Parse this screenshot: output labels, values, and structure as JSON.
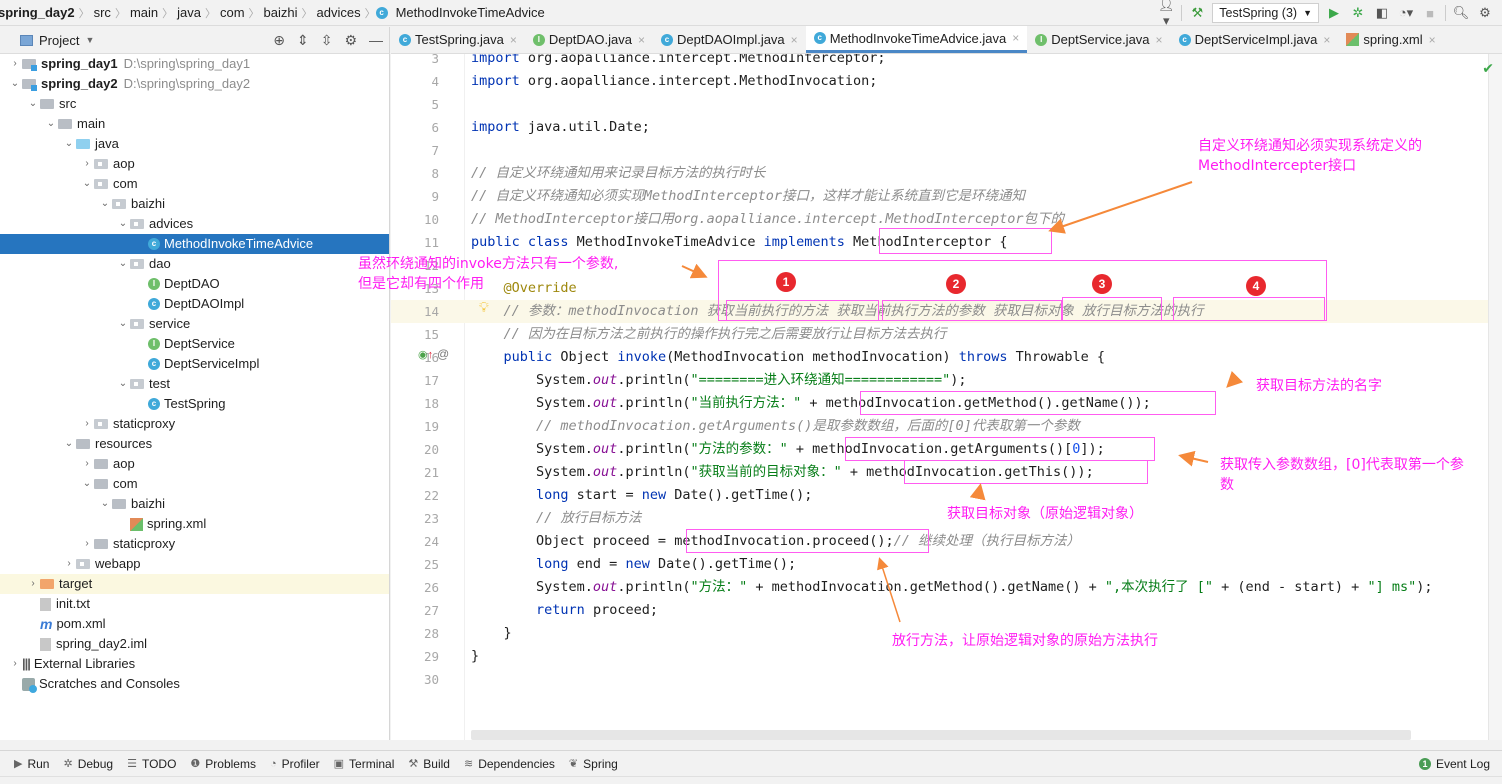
{
  "breadcrumb": [
    "spring_day2",
    "src",
    "main",
    "java",
    "com",
    "baizhi",
    "advices",
    "MethodInvokeTimeAdvice"
  ],
  "toolbar": {
    "run_config": "TestSpring (3)",
    "icons": [
      "user-icon",
      "build-hammer-icon",
      "run-icon",
      "debug-icon",
      "coverage-icon",
      "profile-icon",
      "stop-icon",
      "search-icon",
      "settings-icon"
    ]
  },
  "project_panel": {
    "title": "Project",
    "tree": [
      {
        "label": "spring_day1",
        "path": "D:\\spring\\spring_day1",
        "depth": 0,
        "arrow": "›",
        "icon": "module",
        "bold": true
      },
      {
        "label": "spring_day2",
        "path": "D:\\spring\\spring_day2",
        "depth": 0,
        "arrow": "⌄",
        "icon": "module",
        "bold": true
      },
      {
        "label": "src",
        "depth": 1,
        "arrow": "⌄",
        "icon": "folder"
      },
      {
        "label": "main",
        "depth": 2,
        "arrow": "⌄",
        "icon": "folder"
      },
      {
        "label": "java",
        "depth": 3,
        "arrow": "⌄",
        "icon": "folder-blue"
      },
      {
        "label": "aop",
        "depth": 4,
        "arrow": "›",
        "icon": "package"
      },
      {
        "label": "com",
        "depth": 4,
        "arrow": "⌄",
        "icon": "package"
      },
      {
        "label": "baizhi",
        "depth": 5,
        "arrow": "⌄",
        "icon": "package"
      },
      {
        "label": "advices",
        "depth": 6,
        "arrow": "⌄",
        "icon": "package"
      },
      {
        "label": "MethodInvokeTimeAdvice",
        "depth": 7,
        "arrow": "",
        "icon": "class",
        "selected": true
      },
      {
        "label": "dao",
        "depth": 6,
        "arrow": "⌄",
        "icon": "package"
      },
      {
        "label": "DeptDAO",
        "depth": 7,
        "arrow": "",
        "icon": "interface"
      },
      {
        "label": "DeptDAOImpl",
        "depth": 7,
        "arrow": "",
        "icon": "class"
      },
      {
        "label": "service",
        "depth": 6,
        "arrow": "⌄",
        "icon": "package"
      },
      {
        "label": "DeptService",
        "depth": 7,
        "arrow": "",
        "icon": "interface"
      },
      {
        "label": "DeptServiceImpl",
        "depth": 7,
        "arrow": "",
        "icon": "class"
      },
      {
        "label": "test",
        "depth": 6,
        "arrow": "⌄",
        "icon": "package"
      },
      {
        "label": "TestSpring",
        "depth": 7,
        "arrow": "",
        "icon": "class-run"
      },
      {
        "label": "staticproxy",
        "depth": 4,
        "arrow": "›",
        "icon": "package"
      },
      {
        "label": "resources",
        "depth": 3,
        "arrow": "⌄",
        "icon": "folder"
      },
      {
        "label": "aop",
        "depth": 4,
        "arrow": "›",
        "icon": "folder"
      },
      {
        "label": "com",
        "depth": 4,
        "arrow": "⌄",
        "icon": "folder"
      },
      {
        "label": "baizhi",
        "depth": 5,
        "arrow": "⌄",
        "icon": "folder"
      },
      {
        "label": "spring.xml",
        "depth": 6,
        "arrow": "",
        "icon": "xml"
      },
      {
        "label": "staticproxy",
        "depth": 4,
        "arrow": "›",
        "icon": "folder"
      },
      {
        "label": "webapp",
        "depth": 3,
        "arrow": "›",
        "icon": "package"
      },
      {
        "label": "target",
        "depth": 1,
        "arrow": "›",
        "icon": "folder-orange",
        "highlight": true
      },
      {
        "label": "init.txt",
        "depth": 1,
        "arrow": "",
        "icon": "file"
      },
      {
        "label": "pom.xml",
        "depth": 1,
        "arrow": "",
        "icon": "maven"
      },
      {
        "label": "spring_day2.iml",
        "depth": 1,
        "arrow": "",
        "icon": "file"
      },
      {
        "label": "External Libraries",
        "depth": 0,
        "arrow": "›",
        "icon": "libraries"
      },
      {
        "label": "Scratches and Consoles",
        "depth": 0,
        "arrow": "",
        "icon": "scratches"
      }
    ]
  },
  "tabs": [
    {
      "label": "TestSpring.java",
      "icon": "C",
      "kind": "class"
    },
    {
      "label": "DeptDAO.java",
      "icon": "I",
      "kind": "interface"
    },
    {
      "label": "DeptDAOImpl.java",
      "icon": "C",
      "kind": "class"
    },
    {
      "label": "MethodInvokeTimeAdvice.java",
      "icon": "C",
      "kind": "class",
      "active": true
    },
    {
      "label": "DeptService.java",
      "icon": "I",
      "kind": "interface"
    },
    {
      "label": "DeptServiceImpl.java",
      "icon": "C",
      "kind": "class"
    },
    {
      "label": "spring.xml",
      "icon": "X",
      "kind": "xml"
    }
  ],
  "code_lines": [
    {
      "n": "3",
      "html": "<span class=\"kw\">import</span> org.aopalliance.intercept.MethodInterceptor;"
    },
    {
      "n": "4",
      "html": "<span class=\"kw\">import</span> org.aopalliance.intercept.MethodInvocation;"
    },
    {
      "n": "5",
      "html": ""
    },
    {
      "n": "6",
      "html": "<span class=\"kw\">import</span> java.util.Date;"
    },
    {
      "n": "7",
      "html": ""
    },
    {
      "n": "8",
      "html": "<span class=\"cm\">// 自定义环绕通知用来记录目标方法的执行时长</span>"
    },
    {
      "n": "9",
      "html": "<span class=\"cm\">// 自定义环绕通知必须实现MethodInterceptor接口，这样才能让系统直到它是环绕通知</span>"
    },
    {
      "n": "10",
      "html": "<span class=\"cm\">// MethodInterceptor接口用org.aopalliance.intercept.MethodInterceptor包下的</span>"
    },
    {
      "n": "11",
      "html": "<span class=\"kw\">public class</span> MethodInvokeTimeAdvice <span class=\"kw\">implements</span> MethodInterceptor {"
    },
    {
      "n": "12",
      "html": ""
    },
    {
      "n": "13",
      "html": "    <span class=\"an\">@Override</span>"
    },
    {
      "n": "14",
      "html": "    <span class=\"cm\">// 参数：methodInvocation 获取当前执行的方法 获取当前执行方法的参数 获取目标对象 放行目标方法的执行</span>",
      "current": true
    },
    {
      "n": "15",
      "html": "    <span class=\"cm\">// 因为在目标方法之前执行的操作执行完之后需要放行让目标方法去执行</span>"
    },
    {
      "n": "16",
      "html": "    <span class=\"kw\">public</span> Object <span class=\"kw\">invoke</span>(MethodInvocation methodInvocation) <span class=\"kw\">throws</span> Throwable {"
    },
    {
      "n": "17",
      "html": "        System.<span class=\"fld\">out</span>.println(<span class=\"st\">\"========进入环绕通知============\"</span>);"
    },
    {
      "n": "18",
      "html": "        System.<span class=\"fld\">out</span>.println(<span class=\"st\">\"当前执行方法：\"</span> + methodInvocation.getMethod().getName());"
    },
    {
      "n": "19",
      "html": "        <span class=\"cm\">// methodInvocation.getArguments()是取参数数组，后面的[0]代表取第一个参数</span>"
    },
    {
      "n": "20",
      "html": "        System.<span class=\"fld\">out</span>.println(<span class=\"st\">\"方法的参数：\"</span> + methodInvocation.getArguments()[<span class=\"num\">0</span>]);"
    },
    {
      "n": "21",
      "html": "        System.<span class=\"fld\">out</span>.println(<span class=\"st\">\"获取当前的目标对象：\"</span> + methodInvocation.getThis());"
    },
    {
      "n": "22",
      "html": "        <span class=\"kw\">long</span> start = <span class=\"kw\">new</span> Date().getTime();"
    },
    {
      "n": "23",
      "html": "        <span class=\"cm\">// 放行目标方法</span>"
    },
    {
      "n": "24",
      "html": "        Object proceed = methodInvocation.proceed();<span class=\"cm\">// 继续处理（执行目标方法）</span>"
    },
    {
      "n": "25",
      "html": "        <span class=\"kw\">long</span> end = <span class=\"kw\">new</span> Date().getTime();"
    },
    {
      "n": "26",
      "html": "        System.<span class=\"fld\">out</span>.println(<span class=\"st\">\"方法：\"</span> + methodInvocation.getMethod().getName() + <span class=\"st\">\",本次执行了 [\"</span> + (end - start) + <span class=\"st\">\"] ms\"</span>);"
    },
    {
      "n": "27",
      "html": "        <span class=\"kw\">return</span> proceed;"
    },
    {
      "n": "28",
      "html": "    }"
    },
    {
      "n": "29",
      "html": "}"
    },
    {
      "n": "30",
      "html": ""
    }
  ],
  "annotations": {
    "interface_note": [
      "自定义环绕通知必须实现系统定义的",
      "MethodIntercepter接口"
    ],
    "invoke_note": [
      "虽然环绕通知的invoke方法只有一个参数,",
      "但是它却有四个作用"
    ],
    "badges": [
      "1",
      "2",
      "3",
      "4"
    ],
    "method_name_note": "获取目标方法的名字",
    "arguments_note": [
      "获取传入参数数组，[0]代表取第一个参",
      "数"
    ],
    "target_note": "获取目标对象（原始逻辑对象）",
    "proceed_note": "放行方法，让原始逻辑对象的原始方法执行"
  },
  "bottom_tools": [
    {
      "label": "Run",
      "icon": "▶"
    },
    {
      "label": "Debug",
      "icon": "✲"
    },
    {
      "label": "TODO",
      "icon": "☰"
    },
    {
      "label": "Problems",
      "icon": "❶"
    },
    {
      "label": "Profiler",
      "icon": "◔"
    },
    {
      "label": "Terminal",
      "icon": "▣"
    },
    {
      "label": "Build",
      "icon": "⚒"
    },
    {
      "label": "Dependencies",
      "icon": "≋"
    },
    {
      "label": "Spring",
      "icon": "❦"
    }
  ],
  "event_log": {
    "label": "Event Log",
    "count": "1"
  }
}
